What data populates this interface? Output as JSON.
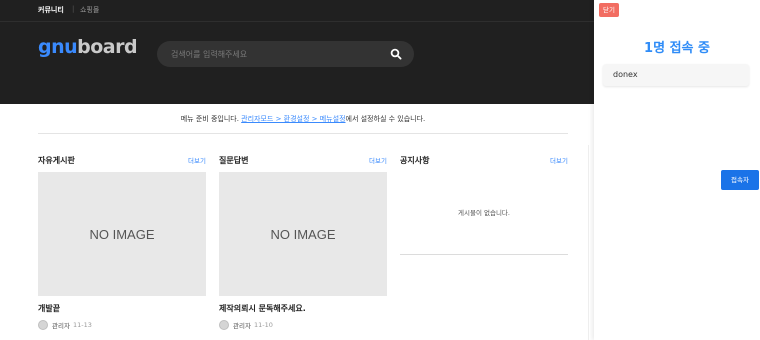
{
  "topbar": {
    "community": "커뮤니티",
    "separator": "|",
    "shop": "쇼핑몰"
  },
  "header": {
    "logo_g": "gnu",
    "logo_rest": "board",
    "search_placeholder": "검색어를 입력해주세요",
    "search_icon": "search-icon"
  },
  "menu_notice": {
    "prefix": "메뉴 준비 중입니다. ",
    "link": "관리자모드 > 환경설정 > 메뉴설정",
    "suffix": "에서 설정하실 수 있습니다."
  },
  "boards": [
    {
      "title": "자유게시판",
      "more": "더보기",
      "thumb": "NO IMAGE",
      "post_title": "개발끝",
      "author": "관리자",
      "date": "11-13"
    },
    {
      "title": "질문답변",
      "more": "더보기",
      "thumb": "NO IMAGE",
      "post_title": "제작의뢰시 문독해주세요.",
      "author": "관리자",
      "date": "11-10"
    },
    {
      "title": "공지사항",
      "more": "더보기",
      "empty": "게시물이 없습니다."
    }
  ],
  "panel": {
    "close_label": "닫기",
    "count_title": "1명 접속 중",
    "users": [
      "donex"
    ],
    "viewer_button": "접속자"
  },
  "colors": {
    "accent": "#3a8afd",
    "header_bg": "#202020",
    "close_bg": "#f26d62",
    "viewer_bg": "#1a73e8"
  }
}
